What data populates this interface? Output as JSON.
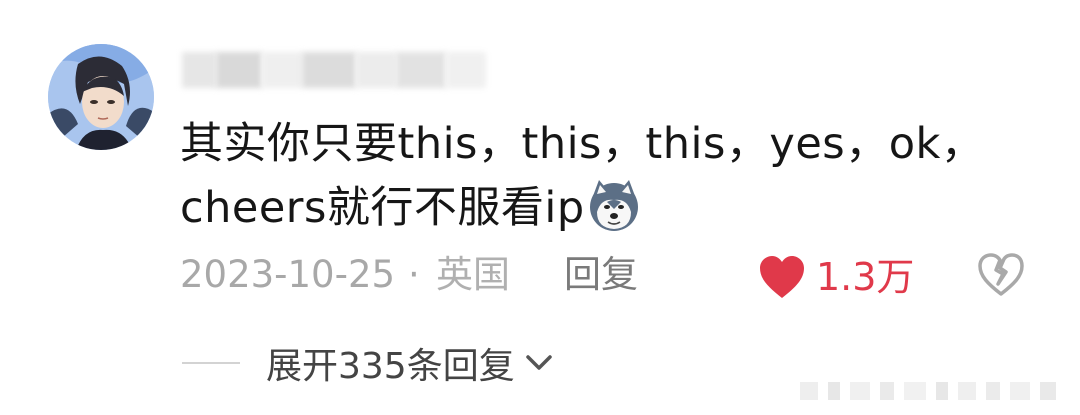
{
  "comment": {
    "text_line1": "其实你只要this，this，this，yes，ok，",
    "text_line2": "cheers就行不服看ip",
    "emoji_icon": "husky-dog-emoji",
    "date": "2023-10-25",
    "separator": "·",
    "location": "英国",
    "reply_label": "回复",
    "like_count": "1.3万",
    "like_color": "#e0394a",
    "expand_label": "展开335条回复"
  }
}
